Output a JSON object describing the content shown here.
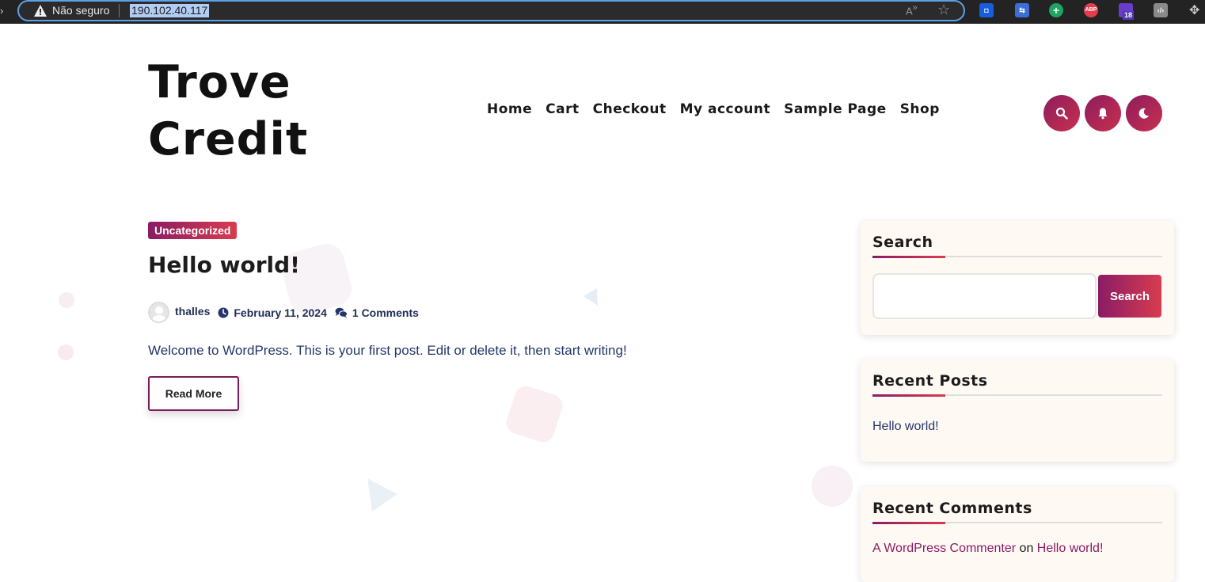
{
  "browser": {
    "security_label": "Não seguro",
    "url": "190.102.40.117",
    "extensions": {
      "abp_label": "ABP",
      "badge_count": "18"
    }
  },
  "site": {
    "title_line1": "Trove",
    "title_line2": "Credit",
    "nav": [
      "Home",
      "Cart",
      "Checkout",
      "My account",
      "Sample Page",
      "Shop"
    ]
  },
  "post": {
    "category": "Uncategorized",
    "title": "Hello world!",
    "author": "thalles",
    "date": "February 11, 2024",
    "comments": "1 Comments",
    "excerpt": "Welcome to WordPress. This is your first post. Edit or delete it, then start writing!",
    "read_more": "Read More"
  },
  "sidebar": {
    "search": {
      "title": "Search",
      "button": "Search",
      "placeholder": ""
    },
    "recent_posts": {
      "title": "Recent Posts",
      "items": [
        "Hello world!"
      ]
    },
    "recent_comments": {
      "title": "Recent Comments",
      "commenter": "A WordPress Commenter",
      "connector": "on",
      "post": "Hello world!"
    }
  },
  "colors": {
    "accent_start": "#8a1c65",
    "accent_end": "#d83c4f",
    "text_dark": "#1c1c1c",
    "link_blue": "#23376a"
  }
}
